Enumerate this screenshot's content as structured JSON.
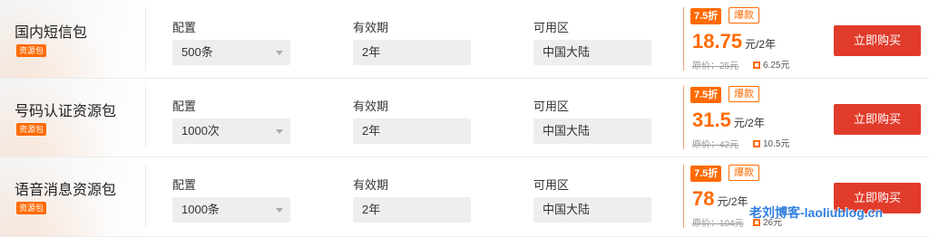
{
  "products": [
    {
      "name": "国内短信包",
      "tag": "资源包",
      "config_label": "配置",
      "config_value": "500条",
      "validity_label": "有效期",
      "validity_value": "2年",
      "region_label": "可用区",
      "region_value": "中国大陆",
      "discount": "7.5折",
      "hot": "爆款",
      "price": "18.75",
      "price_unit": "元/2年",
      "original": "原价：25元",
      "saving": "6.25元",
      "buy_label": "立即购买"
    },
    {
      "name": "号码认证资源包",
      "tag": "资源包",
      "config_label": "配置",
      "config_value": "1000次",
      "validity_label": "有效期",
      "validity_value": "2年",
      "region_label": "可用区",
      "region_value": "中国大陆",
      "discount": "7.5折",
      "hot": "爆款",
      "price": "31.5",
      "price_unit": "元/2年",
      "original": "原价：42元",
      "saving": "10.5元",
      "buy_label": "立即购买"
    },
    {
      "name": "语音消息资源包",
      "tag": "资源包",
      "config_label": "配置",
      "config_value": "1000条",
      "validity_label": "有效期",
      "validity_value": "2年",
      "region_label": "可用区",
      "region_value": "中国大陆",
      "discount": "7.5折",
      "hot": "爆款",
      "price": "78",
      "price_unit": "元/2年",
      "original": "原价：104元",
      "saving": "26元",
      "buy_label": "立即购买"
    }
  ],
  "watermark": "老刘博客-laoliublog.cn",
  "colors": {
    "accent": "#ff6a00",
    "buy_button": "#e13b2b",
    "watermark": "#2f7fe0"
  }
}
